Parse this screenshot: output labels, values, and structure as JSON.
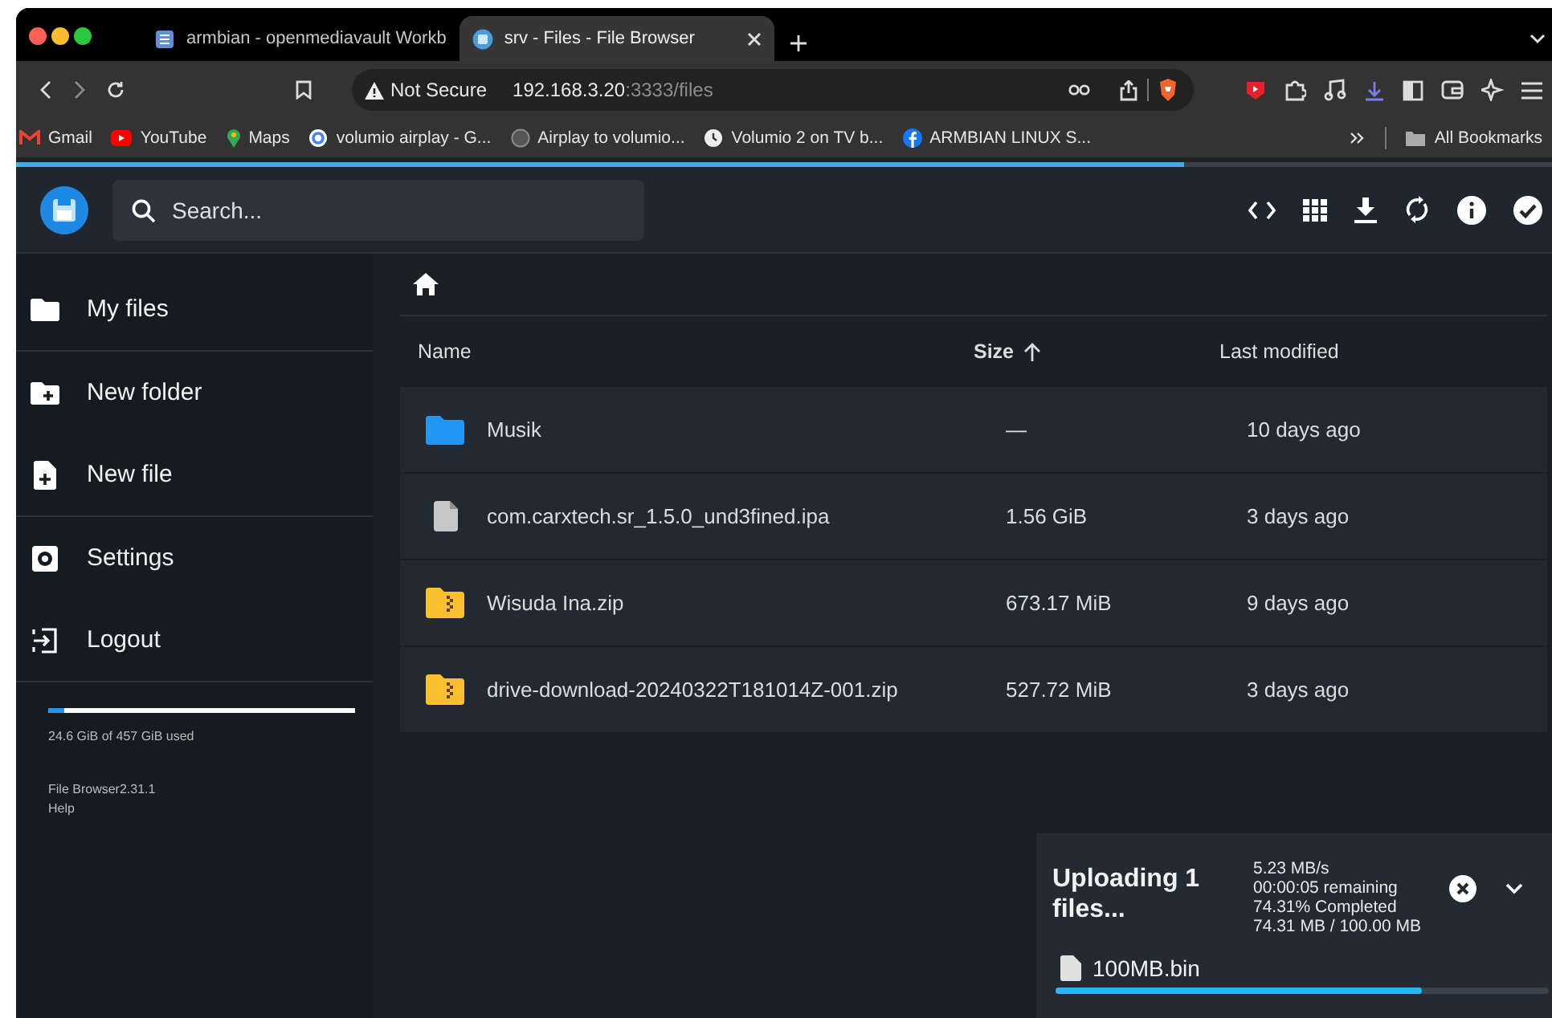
{
  "browser": {
    "tabs": [
      {
        "title": "armbian - openmediavault Workb",
        "kind": "document",
        "selected": false
      },
      {
        "title": "srv - Files - File Browser",
        "kind": "app",
        "selected": true
      }
    ],
    "address": {
      "security": "Not Secure",
      "host": "192.168.3.20",
      "path": ":3333/files"
    },
    "bookmarks": [
      {
        "label": "Gmail",
        "kind": "mail"
      },
      {
        "label": "YouTube",
        "kind": "video"
      },
      {
        "label": "Maps",
        "kind": "pin"
      },
      {
        "label": "volumio airplay - G...",
        "kind": "search"
      },
      {
        "label": "Airplay to volumio...",
        "kind": "code"
      },
      {
        "label": "Volumio 2 on TV b...",
        "kind": "clock"
      },
      {
        "label": "ARMBIAN LINUX S...",
        "kind": "social"
      }
    ],
    "all_bookmarks": "All Bookmarks",
    "page_load": {
      "level": 0.76
    }
  },
  "app": {
    "search": {
      "placeholder": "Search..."
    },
    "sidebar": {
      "groups": [
        [
          {
            "label": "My files",
            "kind": "folder"
          }
        ],
        [
          {
            "label": "New folder",
            "kind": "new-folder"
          },
          {
            "label": "New file",
            "kind": "new-file"
          }
        ],
        [
          {
            "label": "Settings",
            "kind": "settings"
          },
          {
            "label": "Logout",
            "kind": "logout"
          }
        ]
      ]
    },
    "storage": {
      "level": 0.054,
      "text": "24.6 GiB of 457 GiB used"
    },
    "footer": [
      "File Browser2.31.1",
      "Help"
    ],
    "table": {
      "columns": [
        {
          "label": "Name",
          "sorted": false
        },
        {
          "label": "Size",
          "sorted": true
        },
        {
          "label": "Last modified",
          "sorted": false
        }
      ],
      "rows": [
        {
          "kind": "folder",
          "name": "Musik",
          "size": "—",
          "modified": "10 days ago"
        },
        {
          "kind": "file",
          "name": "com.carxtech.sr_1.5.0_und3fined.ipa",
          "size": "1.56 GiB",
          "modified": "3 days ago"
        },
        {
          "kind": "archive",
          "name": "Wisuda Ina.zip",
          "size": "673.17 MiB",
          "modified": "9 days ago"
        },
        {
          "kind": "archive",
          "name": "drive-download-20240322T181014Z-001.zip",
          "size": "527.72 MiB",
          "modified": "3 days ago"
        }
      ]
    },
    "upload": {
      "title": "Uploading 1 files...",
      "stats": [
        "5.23 MB/s",
        "00:00:05 remaining",
        "74.31% Completed",
        "74.31 MB / 100.00 MB"
      ],
      "file": {
        "name": "100MB.bin",
        "level": 0.7431
      }
    }
  }
}
